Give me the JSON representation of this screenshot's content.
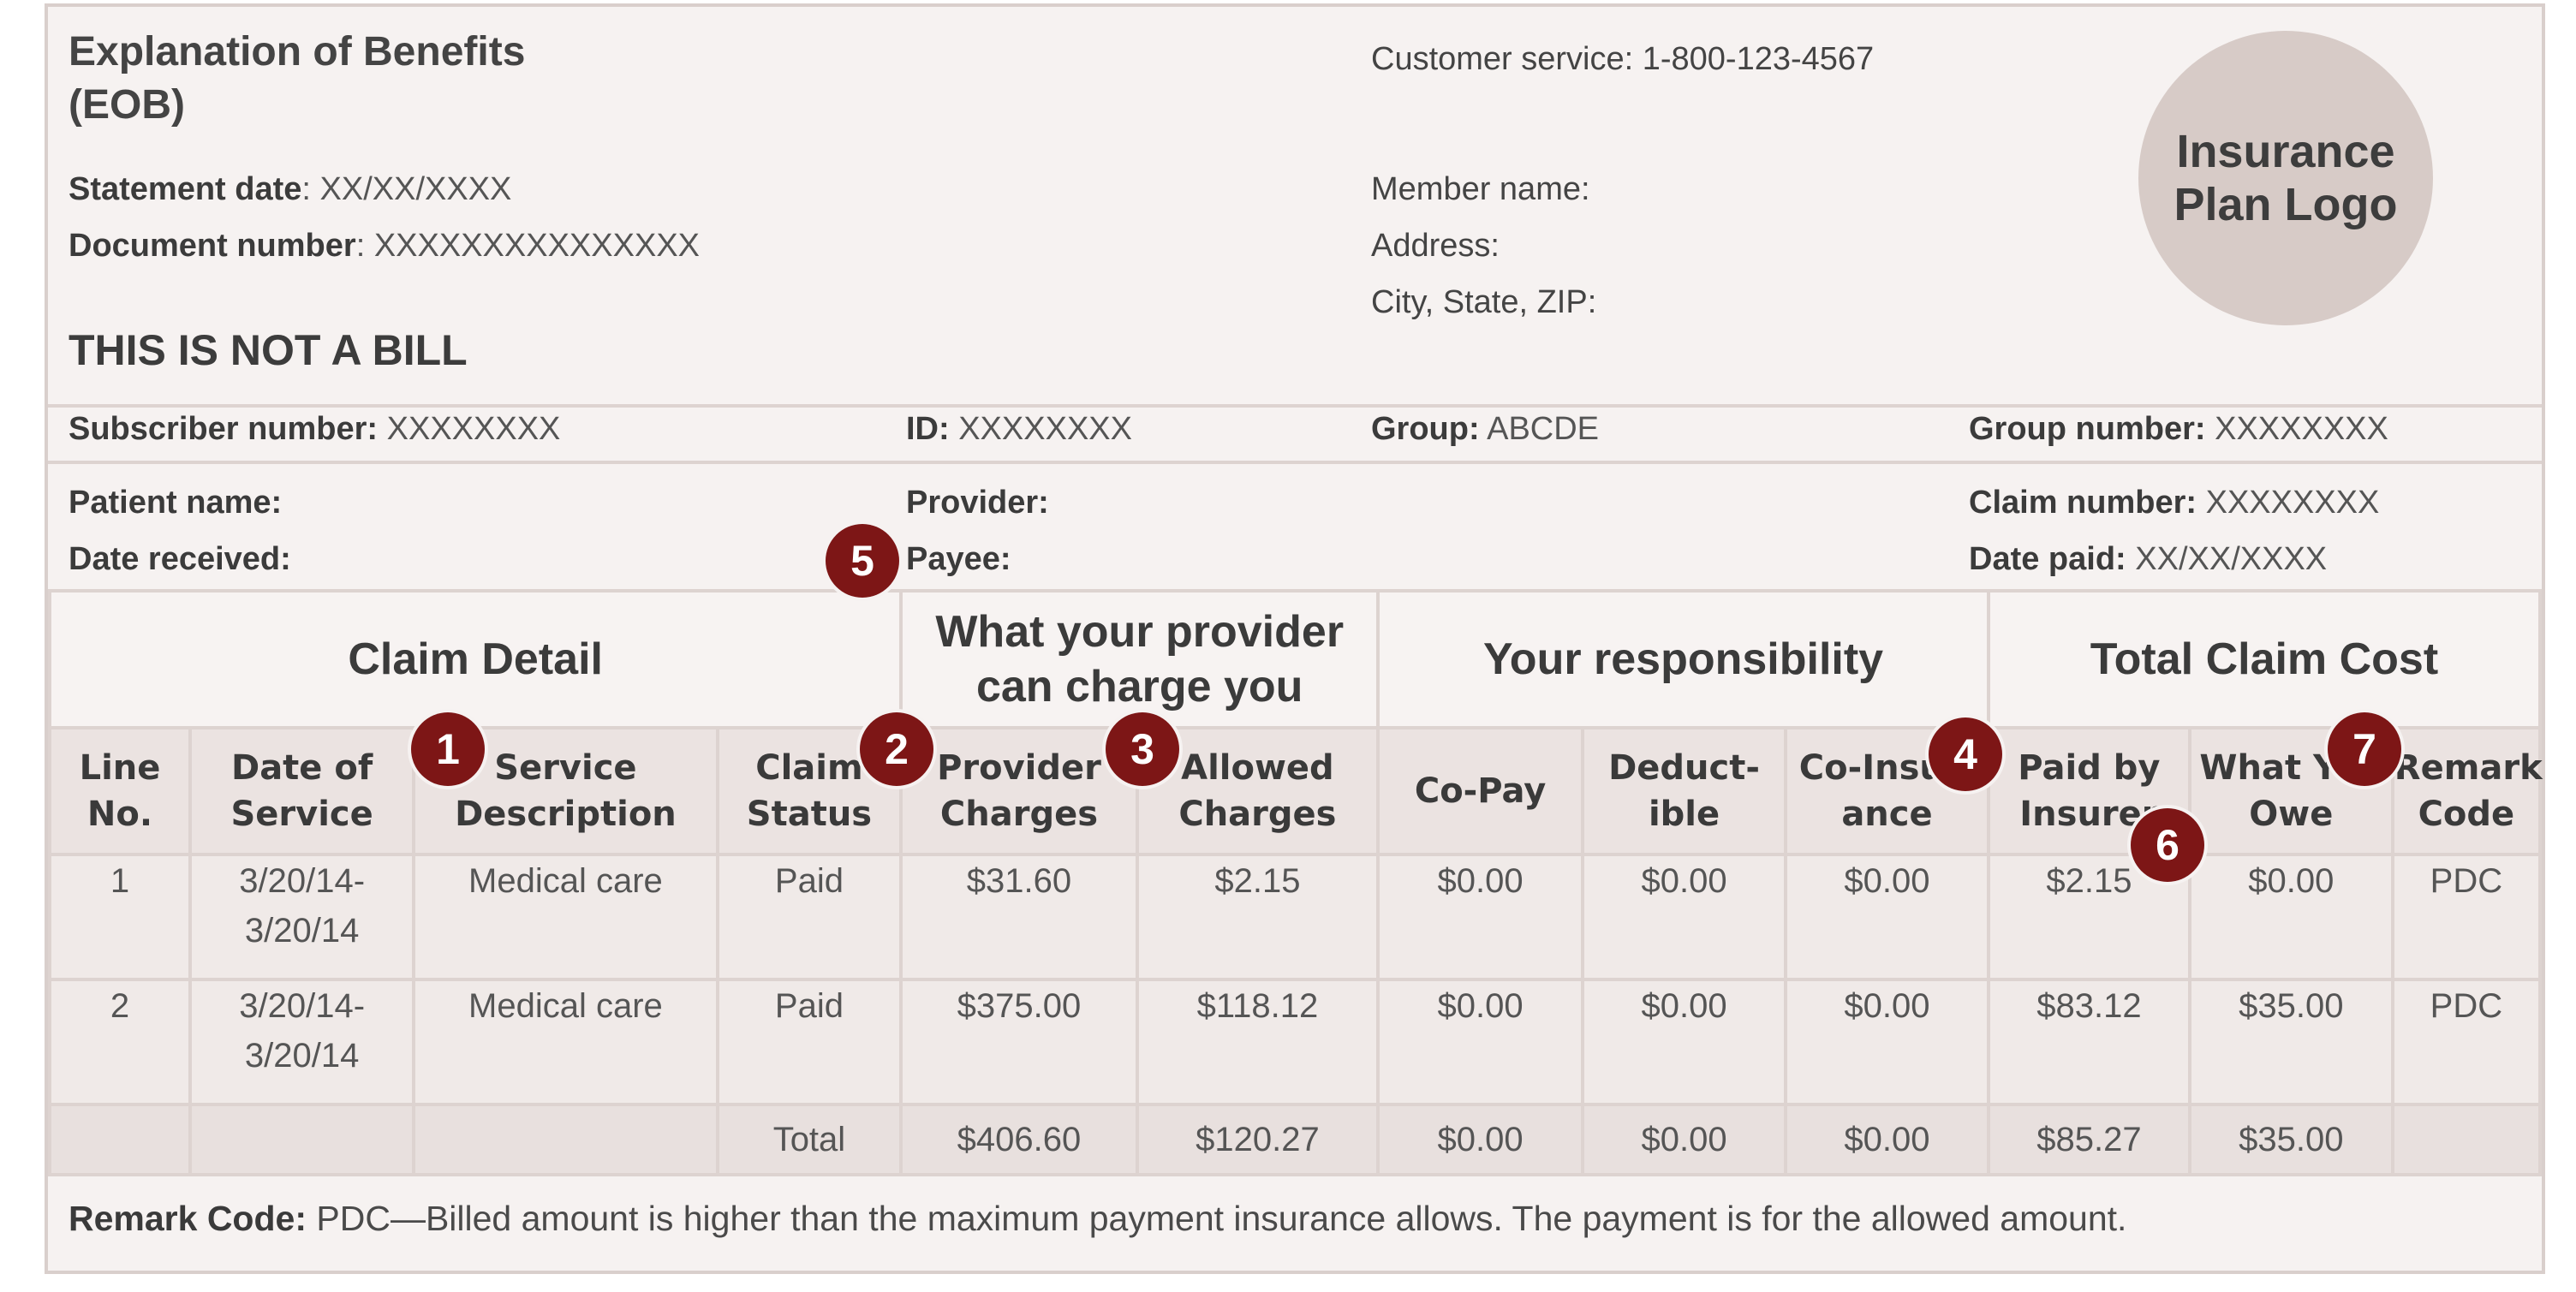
{
  "header": {
    "title": "Explanation of Benefits (EOB)",
    "statement_date_label": "Statement date",
    "statement_date_value": ": XX/XX/XXXX",
    "document_number_label": "Document number",
    "document_number_value": ": XXXXXXXXXXXXXXX",
    "not_a_bill": "THIS IS NOT A BILL",
    "customer_service": "Customer service: 1-800-123-4567",
    "member_name": "Member name:",
    "address": "Address:",
    "city_state_zip": "City, State, ZIP:",
    "logo_text": "Insurance Plan Logo"
  },
  "subscriber_row": {
    "subscriber_label": "Subscriber number:",
    "subscriber_value": " XXXXXXXX",
    "id_label": "ID:",
    "id_value": " XXXXXXXX",
    "group_label": "Group:",
    "group_value": " ABCDE",
    "group_number_label": "Group number:",
    "group_number_value": " XXXXXXXX"
  },
  "patient_block": {
    "patient_name": "Patient name:",
    "date_received": "Date received:",
    "provider": "Provider:",
    "payee": "Payee:",
    "claim_number_label": "Claim number:",
    "claim_number_value": " XXXXXXXX",
    "date_paid_label": "Date paid:",
    "date_paid_value": " XX/XX/XXXX"
  },
  "table": {
    "groups": [
      "Claim Detail",
      "What your provider can charge you",
      "Your responsibility",
      "Total Claim Cost"
    ],
    "columns": [
      "Line No.",
      "Date of Service",
      "Service Description",
      "Claim Status",
      "Provider Charges",
      "Allowed Charges",
      "Co-Pay",
      "Deduct-ible",
      "Co-Insur-ance",
      "Paid by Insurer",
      "What You Owe",
      "Remark Code"
    ],
    "rows": [
      [
        "1",
        "3/20/14-3/20/14",
        "Medical care",
        "Paid",
        "$31.60",
        "$2.15",
        "$0.00",
        "$0.00",
        "$0.00",
        "$2.15",
        "$0.00",
        "PDC"
      ],
      [
        "2",
        "3/20/14-3/20/14",
        "Medical care",
        "Paid",
        "$375.00",
        "$118.12",
        "$0.00",
        "$0.00",
        "$0.00",
        "$83.12",
        "$35.00",
        "PDC"
      ]
    ],
    "total": [
      "",
      "",
      "",
      "Total",
      "$406.60",
      "$120.27",
      "$0.00",
      "$0.00",
      "$0.00",
      "$85.27",
      "$35.00",
      ""
    ]
  },
  "remark": {
    "label": "Remark Code:",
    "text": " PDC—Billed amount is higher than the maximum payment insurance allows. The payment is for the allowed amount."
  },
  "badges": [
    "1",
    "2",
    "3",
    "4",
    "5",
    "6",
    "7"
  ],
  "colors": {
    "badge": "#7d1616",
    "logo_circle": "#d7cbc7",
    "page": "#f6f2f1"
  }
}
